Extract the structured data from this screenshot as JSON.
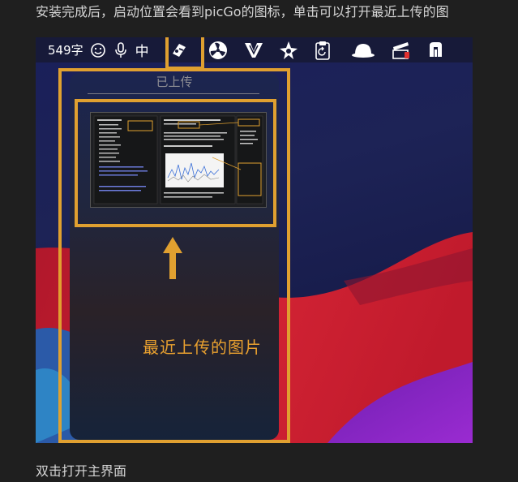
{
  "article": {
    "paragraph_top": "安装完成后，启动位置会看到picGo的图标，单击可以打开最近上传的图",
    "paragraph_bottom": "双击打开主界面"
  },
  "menubar": {
    "word_count": "549字",
    "input_method": "中",
    "icons": [
      "smiley-icon",
      "microphone-icon",
      "picgo-icon",
      "fan-icon",
      "vee-icon",
      "shuriken-icon",
      "clipboard-icon",
      "hat-icon",
      "clapper-icon",
      "cut-icon"
    ]
  },
  "popup": {
    "title": "已上传"
  },
  "annotation": {
    "callout": "最近上传的图片",
    "color": "#e0a030"
  },
  "thumbnail": {
    "note_tags": [
      "文本标记",
      "三MOC笔记",
      "3卡目录标签",
      "笔记元素类型"
    ]
  }
}
